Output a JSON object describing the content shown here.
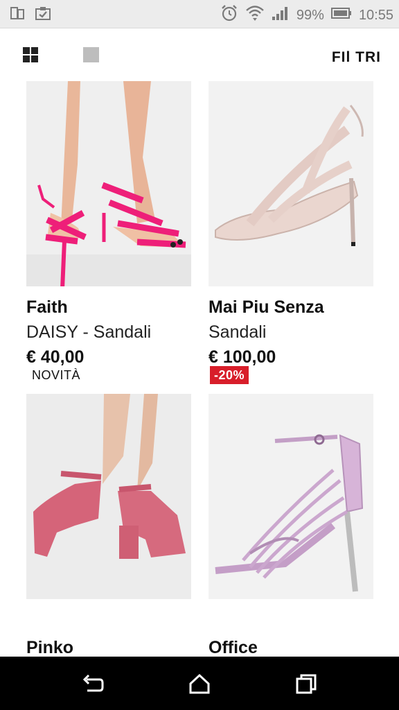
{
  "status_bar": {
    "battery": "99%",
    "time": "10:55",
    "icons": [
      "screen-mirror-icon",
      "clipboard-check-icon",
      "alarm-icon",
      "wifi-icon",
      "signal-icon",
      "battery-icon"
    ]
  },
  "toolbar": {
    "filter_label": "FIl TRI",
    "view_icons": [
      "grid-view-icon",
      "single-view-icon"
    ]
  },
  "products": [
    {
      "brand": "Faith",
      "name": "DAISY - Sandali",
      "price": "€ 40,00",
      "badge": ""
    },
    {
      "brand": "Mai Piu Senza",
      "name": "Sandali",
      "price": "€ 100,00",
      "badge": ""
    },
    {
      "brand": "Pinko",
      "name": "",
      "price": "",
      "badge": "NOVITÀ"
    },
    {
      "brand": "Office",
      "name": "",
      "price": "",
      "badge": "-20%"
    }
  ],
  "nav": [
    "back-icon",
    "home-icon",
    "recents-icon"
  ],
  "colors": {
    "sale_badge": "#d81e2a",
    "nav_bg": "#000000",
    "status_bg": "#ececec"
  }
}
